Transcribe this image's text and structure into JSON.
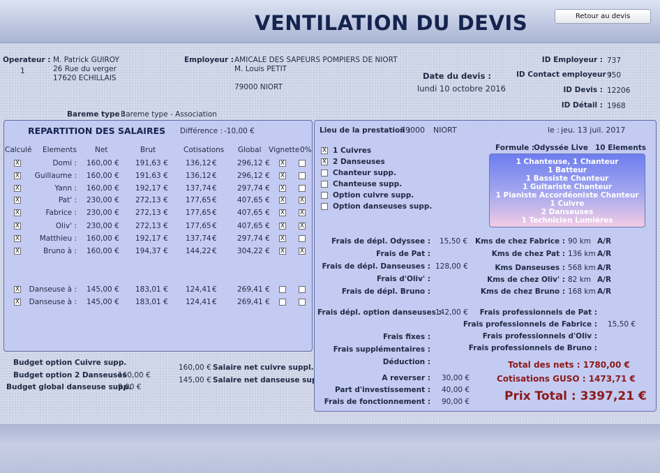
{
  "header": {
    "title": "VENTILATION DU DEVIS",
    "back_button": "Retour au devis"
  },
  "operateur": {
    "label": "Operateur :",
    "index": "1",
    "name": "M. Patrick GUIROY",
    "street": "26 Rue du verger",
    "city": "17620 ECHILLAIS"
  },
  "employeur": {
    "label": "Employeur :",
    "name": "AMICALE DES SAPEURS POMPIERS DE NIORT",
    "contact": "M. Louis PETIT",
    "city": "79000 NIORT"
  },
  "devis": {
    "date_label": "Date du devis :",
    "date_value": "lundi 10 octobre 2016"
  },
  "ids": {
    "employeur_label": "ID Employeur :",
    "employeur_value": "737",
    "contact_label": "ID Contact employeur :",
    "contact_value": "950",
    "devis_label": "ID Devis :",
    "devis_value": "12206",
    "detail_label": "ID Détail :",
    "detail_value": "1968"
  },
  "bareme": {
    "label": "Bareme type :",
    "value": "Bareme type - Association"
  },
  "repartition": {
    "title": "REPARTITION DES SALAIRES",
    "difference_label": "Différence :",
    "difference_value": "-10,00 €",
    "columns": [
      "Calculé",
      "Elements",
      "Net",
      "Brut",
      "Cotisations",
      "Global",
      "Vignette",
      "0%"
    ],
    "rows": [
      {
        "calc": "X",
        "name": "Domi :",
        "net": "160,00 €",
        "brut": "191,63 €",
        "cotis": "136,12",
        "global": "296,12 €",
        "vign": "X",
        "zero": ""
      },
      {
        "calc": "X",
        "name": "Guillaume :",
        "net": "160,00 €",
        "brut": "191,63 €",
        "cotis": "136,12",
        "global": "296,12 €",
        "vign": "X",
        "zero": ""
      },
      {
        "calc": "X",
        "name": "Yann :",
        "net": "160,00 €",
        "brut": "192,17 €",
        "cotis": "137,74",
        "global": "297,74 €",
        "vign": "X",
        "zero": ""
      },
      {
        "calc": "X",
        "name": "Pat' :",
        "net": "230,00 €",
        "brut": "272,13 €",
        "cotis": "177,65",
        "global": "407,65 €",
        "vign": "X",
        "zero": "X"
      },
      {
        "calc": "X",
        "name": "Fabrice :",
        "net": "230,00 €",
        "brut": "272,13 €",
        "cotis": "177,65",
        "global": "407,65 €",
        "vign": "X",
        "zero": "X"
      },
      {
        "calc": "X",
        "name": "Oliv' :",
        "net": "230,00 €",
        "brut": "272,13 €",
        "cotis": "177,65",
        "global": "407,65 €",
        "vign": "X",
        "zero": "X"
      },
      {
        "calc": "X",
        "name": "Matthieu :",
        "net": "160,00 €",
        "brut": "192,17 €",
        "cotis": "137,74",
        "global": "297,74 €",
        "vign": "X",
        "zero": ""
      },
      {
        "calc": "X",
        "name": "Bruno à :",
        "net": "160,00 €",
        "brut": "194,37 €",
        "cotis": "144,22",
        "global": "304,22 €",
        "vign": "X",
        "zero": "X"
      },
      {
        "calc": "X",
        "name": "Danseuse à :",
        "net": "145,00 €",
        "brut": "183,01 €",
        "cotis": "124,41",
        "global": "269,41 €",
        "vign": "",
        "zero": ""
      },
      {
        "calc": "X",
        "name": "Danseuse à :",
        "net": "145,00 €",
        "brut": "183,01 €",
        "cotis": "124,41",
        "global": "269,41 €",
        "vign": "",
        "zero": ""
      }
    ],
    "euro": "€"
  },
  "budgets": {
    "cuivre_label": "Budget option Cuivre supp.",
    "danseuses_label": "Budget option 2 Danseuses",
    "danseuses_value": "160,00 €",
    "global_label": "Budget global danseuse supp.",
    "global_value": "9,00 €",
    "salaire_cuivre_value": "160,00 €",
    "salaire_cuivre_label": "Salaire net cuivre suppl.",
    "salaire_danseuse_value": "145,00 €",
    "salaire_danseuse_label": "Salaire net danseuse supp."
  },
  "prestation": {
    "lieu_label": "Lieu de la prestation :",
    "lieu_cp": "79000",
    "lieu_ville": "NIORT",
    "date_label": "le :",
    "date_value": "jeu. 13 juil. 2017",
    "options": [
      {
        "checked": "X",
        "label": "1  Cuivres"
      },
      {
        "checked": "X",
        "label": "2  Danseuses"
      },
      {
        "checked": "",
        "label": "Chanteur supp."
      },
      {
        "checked": "",
        "label": "Chanteuse supp."
      },
      {
        "checked": "",
        "label": "Option cuivre supp."
      },
      {
        "checked": "",
        "label": "Option danseuses supp."
      }
    ],
    "formule_label": "Formule :",
    "formule_value": "Odyssée Live",
    "elements_count": "10 Elements",
    "formule_lines": [
      "1 Chanteuse, 1 Chanteur",
      "1 Batteur",
      "1 Bassiste Chanteur",
      "1 Guitariste Chanteur",
      "1 Pianiste Accordéoniste Chanteur",
      "1 Cuivre",
      "2 Danseuses",
      "1 Technicien Lumières"
    ]
  },
  "frais": {
    "odyssee_label": "Frais de dépl. Odyssee :",
    "odyssee_value": "15,50 €",
    "pat_label": "Frais de Pat :",
    "danseuses_label": "Frais de dépl. Danseuses :",
    "danseuses_value": "128,00 €",
    "oliv_label": "Frais d'Oliv' :",
    "bruno_label": "Frais de dépl. Bruno :",
    "option_danseuses_label": "Frais dépl. option danseuses :",
    "option_danseuses_value": "142,00 €",
    "fixes_label": "Frais fixes :",
    "supp_label": "Frais supplémentaires :",
    "deduction_label": "Déduction :",
    "reverser_label": "A reverser :",
    "reverser_value": "30,00 €",
    "investissement_label": "Part d'investissement :",
    "investissement_value": "40,00 €",
    "fonctionnement_label": "Frais de fonctionnement :",
    "fonctionnement_value": "90,00 €"
  },
  "kms": {
    "fabrice_label": "Kms de chez Fabrice :",
    "fabrice_value": "90 km",
    "fabrice_ar": "A/R",
    "pat_label": "Kms de chez Pat :",
    "pat_value": "136 km",
    "pat_ar": "A/R",
    "danseuses_label": "Kms Danseuses :",
    "danseuses_value": "568 km",
    "danseuses_ar": "A/R",
    "oliv_label": "Kms de chez Oliv' :",
    "oliv_value": "82 km",
    "oliv_ar": "A/R",
    "bruno_label": "Kms de chez Bruno :",
    "bruno_value": "168 km",
    "bruno_ar": "A/R"
  },
  "frais_pro": {
    "pat_label": "Frais professionnels de Pat :",
    "fabrice_label": "Frais professionnels de Fabrice :",
    "fabrice_value": "15,50 €",
    "oliv_label": "Frais professionnels d'Oliv :",
    "bruno_label": "Frais professionnels de Bruno :"
  },
  "totaux": {
    "nets": "Total des nets : 1780,00 €",
    "guso": "Cotisations GUSO : 1473,71 €",
    "prix": "Prix Total : 3397,21 €"
  },
  "colors": {
    "accent": "#14244e",
    "panel": "#c4cbf2",
    "total_red": "#8b1a1a"
  }
}
